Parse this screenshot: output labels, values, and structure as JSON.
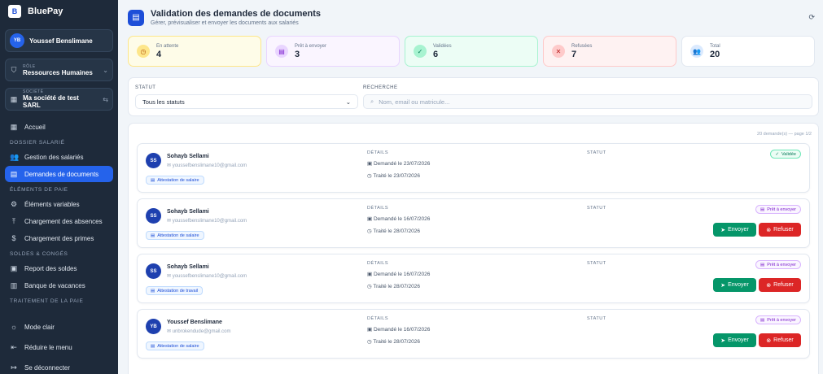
{
  "brand": {
    "name": "BluePay",
    "logo": "B"
  },
  "user": {
    "initials": "YB",
    "name": "Youssef Benslimane"
  },
  "role": {
    "label": "RÔLE",
    "value": "Ressources Humaines"
  },
  "company": {
    "label": "SOCIÉTÉ",
    "value": "Ma société de test SARL"
  },
  "nav": {
    "home": "Accueil",
    "sec_dossier": "DOSSIER SALARIÉ",
    "employees": "Gestion des salariés",
    "requests": "Demandes de documents",
    "sec_elements": "ÉLÉMENTS DE PAIE",
    "variables": "Éléments variables",
    "absences": "Chargement des absences",
    "primes": "Chargement des primes",
    "sec_soldes": "SOLDES & CONGÉS",
    "report": "Report des soldes",
    "bank": "Banque de vacances",
    "sec_traitement": "TRAITEMENT DE LA PAIE",
    "light": "Mode clair",
    "collapse": "Réduire le menu",
    "logout": "Se déconnecter"
  },
  "page": {
    "title": "Validation des demandes de documents",
    "subtitle": "Gérer, prévisualiser et envoyer les documents aux salariés"
  },
  "stats": [
    {
      "label": "En attente",
      "value": "4",
      "bg": "#fefce8",
      "border": "#fde68a",
      "icon_bg": "#fde68a",
      "icon_color": "#b45309",
      "icon": "clock-icon"
    },
    {
      "label": "Prêt à envoyer",
      "value": "3",
      "bg": "#faf5ff",
      "border": "#e9d5ff",
      "icon_bg": "#e9d5ff",
      "icon_color": "#7e22ce",
      "icon": "document-icon"
    },
    {
      "label": "Validées",
      "value": "6",
      "bg": "#ecfdf5",
      "border": "#a7f3d0",
      "icon_bg": "#a7f3d0",
      "icon_color": "#047857",
      "icon": "check-icon"
    },
    {
      "label": "Refusées",
      "value": "7",
      "bg": "#fef2f2",
      "border": "#fecaca",
      "icon_bg": "#fecaca",
      "icon_color": "#b91c1c",
      "icon": "x-icon"
    },
    {
      "label": "Total",
      "value": "20",
      "bg": "#ffffff",
      "border": "#e2e8f0",
      "icon_bg": "#dbeafe",
      "icon_color": "#1d4ed8",
      "icon": "users-icon"
    }
  ],
  "filters": {
    "status_label": "STATUT",
    "status_value": "Tous les statuts",
    "search_label": "RECHERCHE",
    "search_placeholder": "Nom, email ou matricule..."
  },
  "list": {
    "count": "20 demande(s) — page 1/2"
  },
  "labels": {
    "details": "DÉTAILS",
    "status": "STATUT",
    "send": "Envoyer",
    "refuse": "Refuser"
  },
  "rows": [
    {
      "initials": "SS",
      "name": "Sohayb Sellami",
      "email": "youssefbenslimane10@gmail.com",
      "doc": "Attestation de salaire",
      "requested": "Demandé le 23/07/2026",
      "processed": "Traité le 23/07/2026",
      "status": "Validée",
      "type": "green",
      "actions": false
    },
    {
      "initials": "SS",
      "name": "Sohayb Sellami",
      "email": "youssefbenslimane10@gmail.com",
      "doc": "Attestation de salaire",
      "requested": "Demandé le 16/07/2026",
      "processed": "Traité le 28/07/2026",
      "status": "Prêt à envoyer",
      "type": "purple",
      "actions": true
    },
    {
      "initials": "SS",
      "name": "Sohayb Sellami",
      "email": "youssefbenslimane10@gmail.com",
      "doc": "Attestation de travail",
      "requested": "Demandé le 16/07/2026",
      "processed": "Traité le 28/07/2026",
      "status": "Prêt à envoyer",
      "type": "purple",
      "actions": true
    },
    {
      "initials": "YB",
      "name": "Youssef Benslimane",
      "email": "unbrokendude@gmail.com",
      "doc": "Attestation de salaire",
      "requested": "Demandé le 16/07/2026",
      "processed": "Traité le 28/07/2026",
      "status": "Prêt à envoyer",
      "type": "purple",
      "actions": true
    }
  ]
}
